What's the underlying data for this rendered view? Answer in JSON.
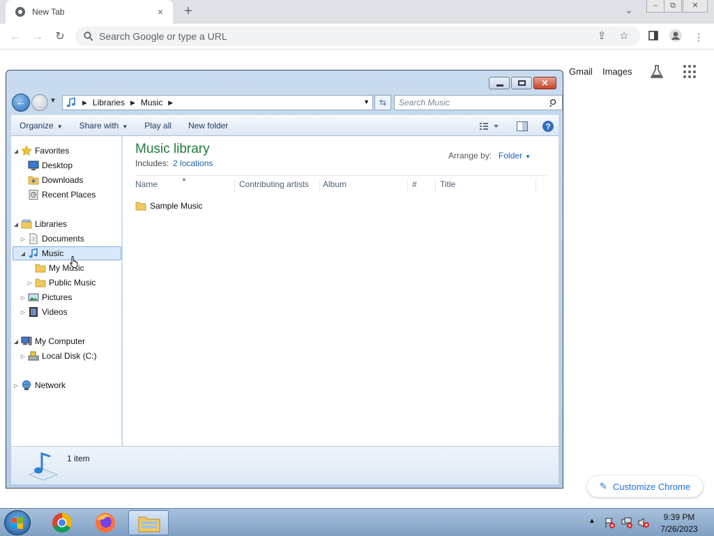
{
  "browser": {
    "tab_title": "New Tab",
    "tab_close": "×",
    "new_tab": "+",
    "tabs_dropdown": "⌄",
    "omnibox_placeholder": "Search Google or type a URL",
    "window_controls": [
      "–",
      "⧉",
      "✕"
    ]
  },
  "ntp": {
    "gmail": "Gmail",
    "images": "Images",
    "customize": "Customize Chrome"
  },
  "explorer": {
    "address": {
      "crumbs": [
        "Libraries",
        "Music"
      ]
    },
    "search_placeholder": "Search Music",
    "commands": [
      "Organize",
      "Share with",
      "Play all",
      "New folder"
    ],
    "tree": {
      "favorites": "Favorites",
      "desktop": "Desktop",
      "downloads": "Downloads",
      "recent": "Recent Places",
      "libraries": "Libraries",
      "documents": "Documents",
      "music": "Music",
      "my_music": "My Music",
      "public_music": "Public Music",
      "pictures": "Pictures",
      "videos": "Videos",
      "computer": "My Computer",
      "local_disk": "Local Disk (C:)",
      "network": "Network"
    },
    "content": {
      "title": "Music library",
      "includes_label": "Includes:",
      "includes_link": "2 locations",
      "arrange_label": "Arrange by:",
      "arrange_value": "Folder",
      "columns": [
        "Name",
        "Contributing artists",
        "Album",
        "#",
        "Title"
      ],
      "rows": [
        {
          "name": "Sample Music"
        }
      ]
    },
    "details": {
      "count": "1 item"
    }
  },
  "taskbar": {
    "time": "9:39 PM",
    "date": "7/26/2023"
  }
}
